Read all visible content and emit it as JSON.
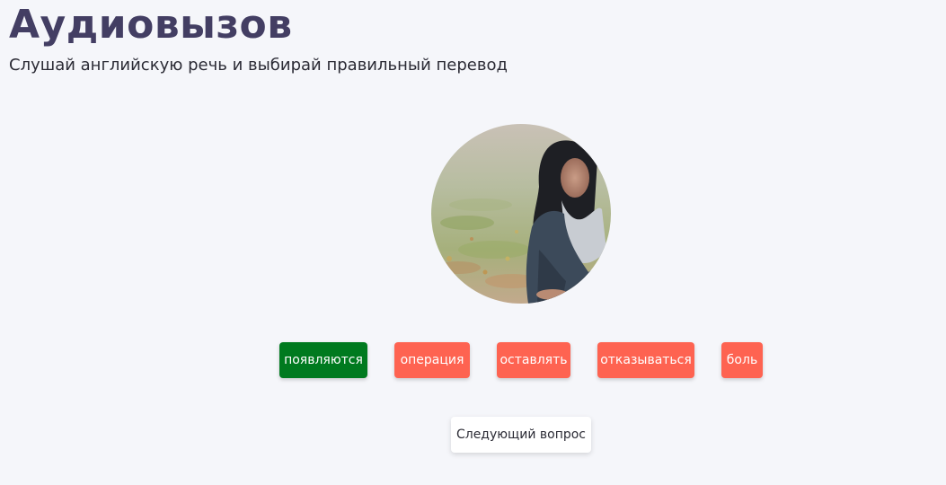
{
  "header": {
    "title": "Аудиовызов",
    "subtitle": "Слушай английскую речь и выбирай правильный перевод"
  },
  "question": {
    "image_alt": "woman-sitting-on-grass-photo"
  },
  "answers": [
    {
      "label": "появляются",
      "state": "correct",
      "color": "#007a1f"
    },
    {
      "label": "операция",
      "state": "wrong",
      "color": "#fe6351"
    },
    {
      "label": "оставлять",
      "state": "wrong",
      "color": "#fe6351"
    },
    {
      "label": "отказываться",
      "state": "wrong",
      "color": "#fe6351"
    },
    {
      "label": "боль",
      "state": "wrong",
      "color": "#fe6351"
    }
  ],
  "next_button": {
    "label": "Следующий вопрос"
  },
  "colors": {
    "title": "#433e63",
    "background": "#f5f6fa",
    "correct": "#007a1f",
    "wrong": "#fe6351"
  }
}
